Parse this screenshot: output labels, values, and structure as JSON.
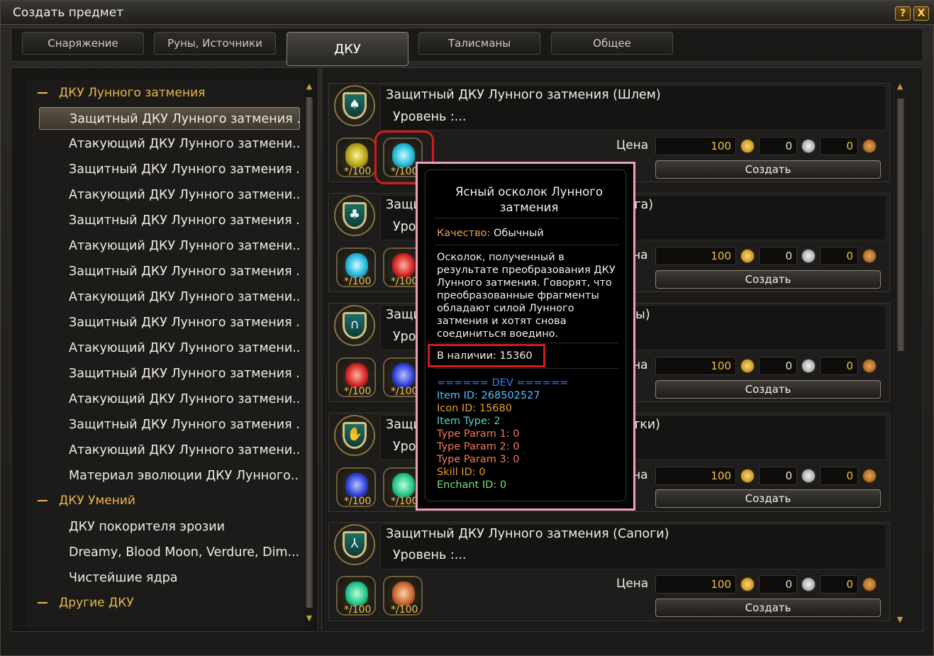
{
  "window": {
    "title": "Создать предмет",
    "help_label": "?",
    "close_label": "X"
  },
  "tabs": [
    "Снаряжение",
    "Руны, Источники",
    "ДКУ",
    "Талисманы",
    "Общее"
  ],
  "tree": {
    "cat1": "ДКУ Лунного затмения",
    "items1": [
      "Защитный ДКУ Лунного затмения ...",
      "Атакующий ДКУ Лунного затмени...",
      "Защитный ДКУ Лунного затмения ...",
      "Атакующий ДКУ Лунного затмени...",
      "Защитный ДКУ Лунного затмения ...",
      "Атакующий ДКУ Лунного затмени...",
      "Защитный ДКУ Лунного затмения ...",
      "Атакующий ДКУ Лунного затмени...",
      "Защитный ДКУ Лунного затмения ...",
      "Атакующий ДКУ Лунного затмени...",
      "Защитный ДКУ Лунного затмения ...",
      "Атакующий ДКУ Лунного затмени...",
      "Защитный ДКУ Лунного затмения ...",
      "Атакующий ДКУ Лунного затмени...",
      "Материал эволюции ДКУ Лунного..."
    ],
    "cat2": "ДКУ Умений",
    "items2": [
      "ДКУ покорителя эрозии",
      "Dreamy, Blood Moon, Verdure, Dim...",
      "Чистейшие ядра"
    ],
    "cat3": "Другие ДКУ"
  },
  "cards": [
    {
      "name": "Защитный ДКУ Лунного затмения (Шлем)",
      "level": "Уровень :...",
      "price_label": "Цена",
      "gold": "100",
      "silver": "0",
      "copper": "0",
      "create": "Создать",
      "mat_count": "*/100"
    },
    {
      "name": "Защи",
      "name_tail": "уга)",
      "level": "Уро",
      "price_label": "на",
      "gold": "100",
      "silver": "0",
      "copper": "0",
      "create": "Создать",
      "mat_count": "*/100"
    },
    {
      "name": "Защи",
      "name_tail": "ы)",
      "level": "Уро",
      "price_label": "на",
      "gold": "100",
      "silver": "0",
      "copper": "0",
      "create": "Создать",
      "mat_count": "*/100"
    },
    {
      "name": "Защи",
      "name_tail": "тки)",
      "level": "Уро",
      "price_label": "на",
      "gold": "100",
      "silver": "0",
      "copper": "0",
      "create": "Создать",
      "mat_count": "*/100"
    },
    {
      "name": "Защитный ДКУ Лунного затмения (Сапоги)",
      "level": "Уровень :...",
      "price_label": "Цена",
      "gold": "100",
      "silver": "0",
      "copper": "0",
      "create": "Создать",
      "mat_count": "*/100"
    }
  ],
  "tooltip": {
    "title": "Ясный осколок Лунного затмения",
    "quality_label": "Качество:",
    "quality_value": "Обычный",
    "desc": [
      "Осколок, полученный в",
      "результате преобразования ДКУ",
      "Лунного затмения. Говорят, что",
      "преобразованные фрагменты",
      "обладают силой Лунного",
      "затмения и хотят снова",
      "соединиться воедино."
    ],
    "stock": "В наличии: 15360",
    "dev_header": "====== DEV ======",
    "item_id": "Item ID: 268502527",
    "icon_id": "Icon ID: 15680",
    "item_type": "Item Type: 2",
    "tp1": "Type Param 1: 0",
    "tp2": "Type Param 2: 0",
    "tp3": "Type Param 3: 0",
    "skill": "Skill ID: 0",
    "enchant": "Enchant ID: 0"
  },
  "colors": {
    "accent": "#e9b84a",
    "highlight": "#d41a1a",
    "tooltip_border": "#f0a0bf"
  }
}
